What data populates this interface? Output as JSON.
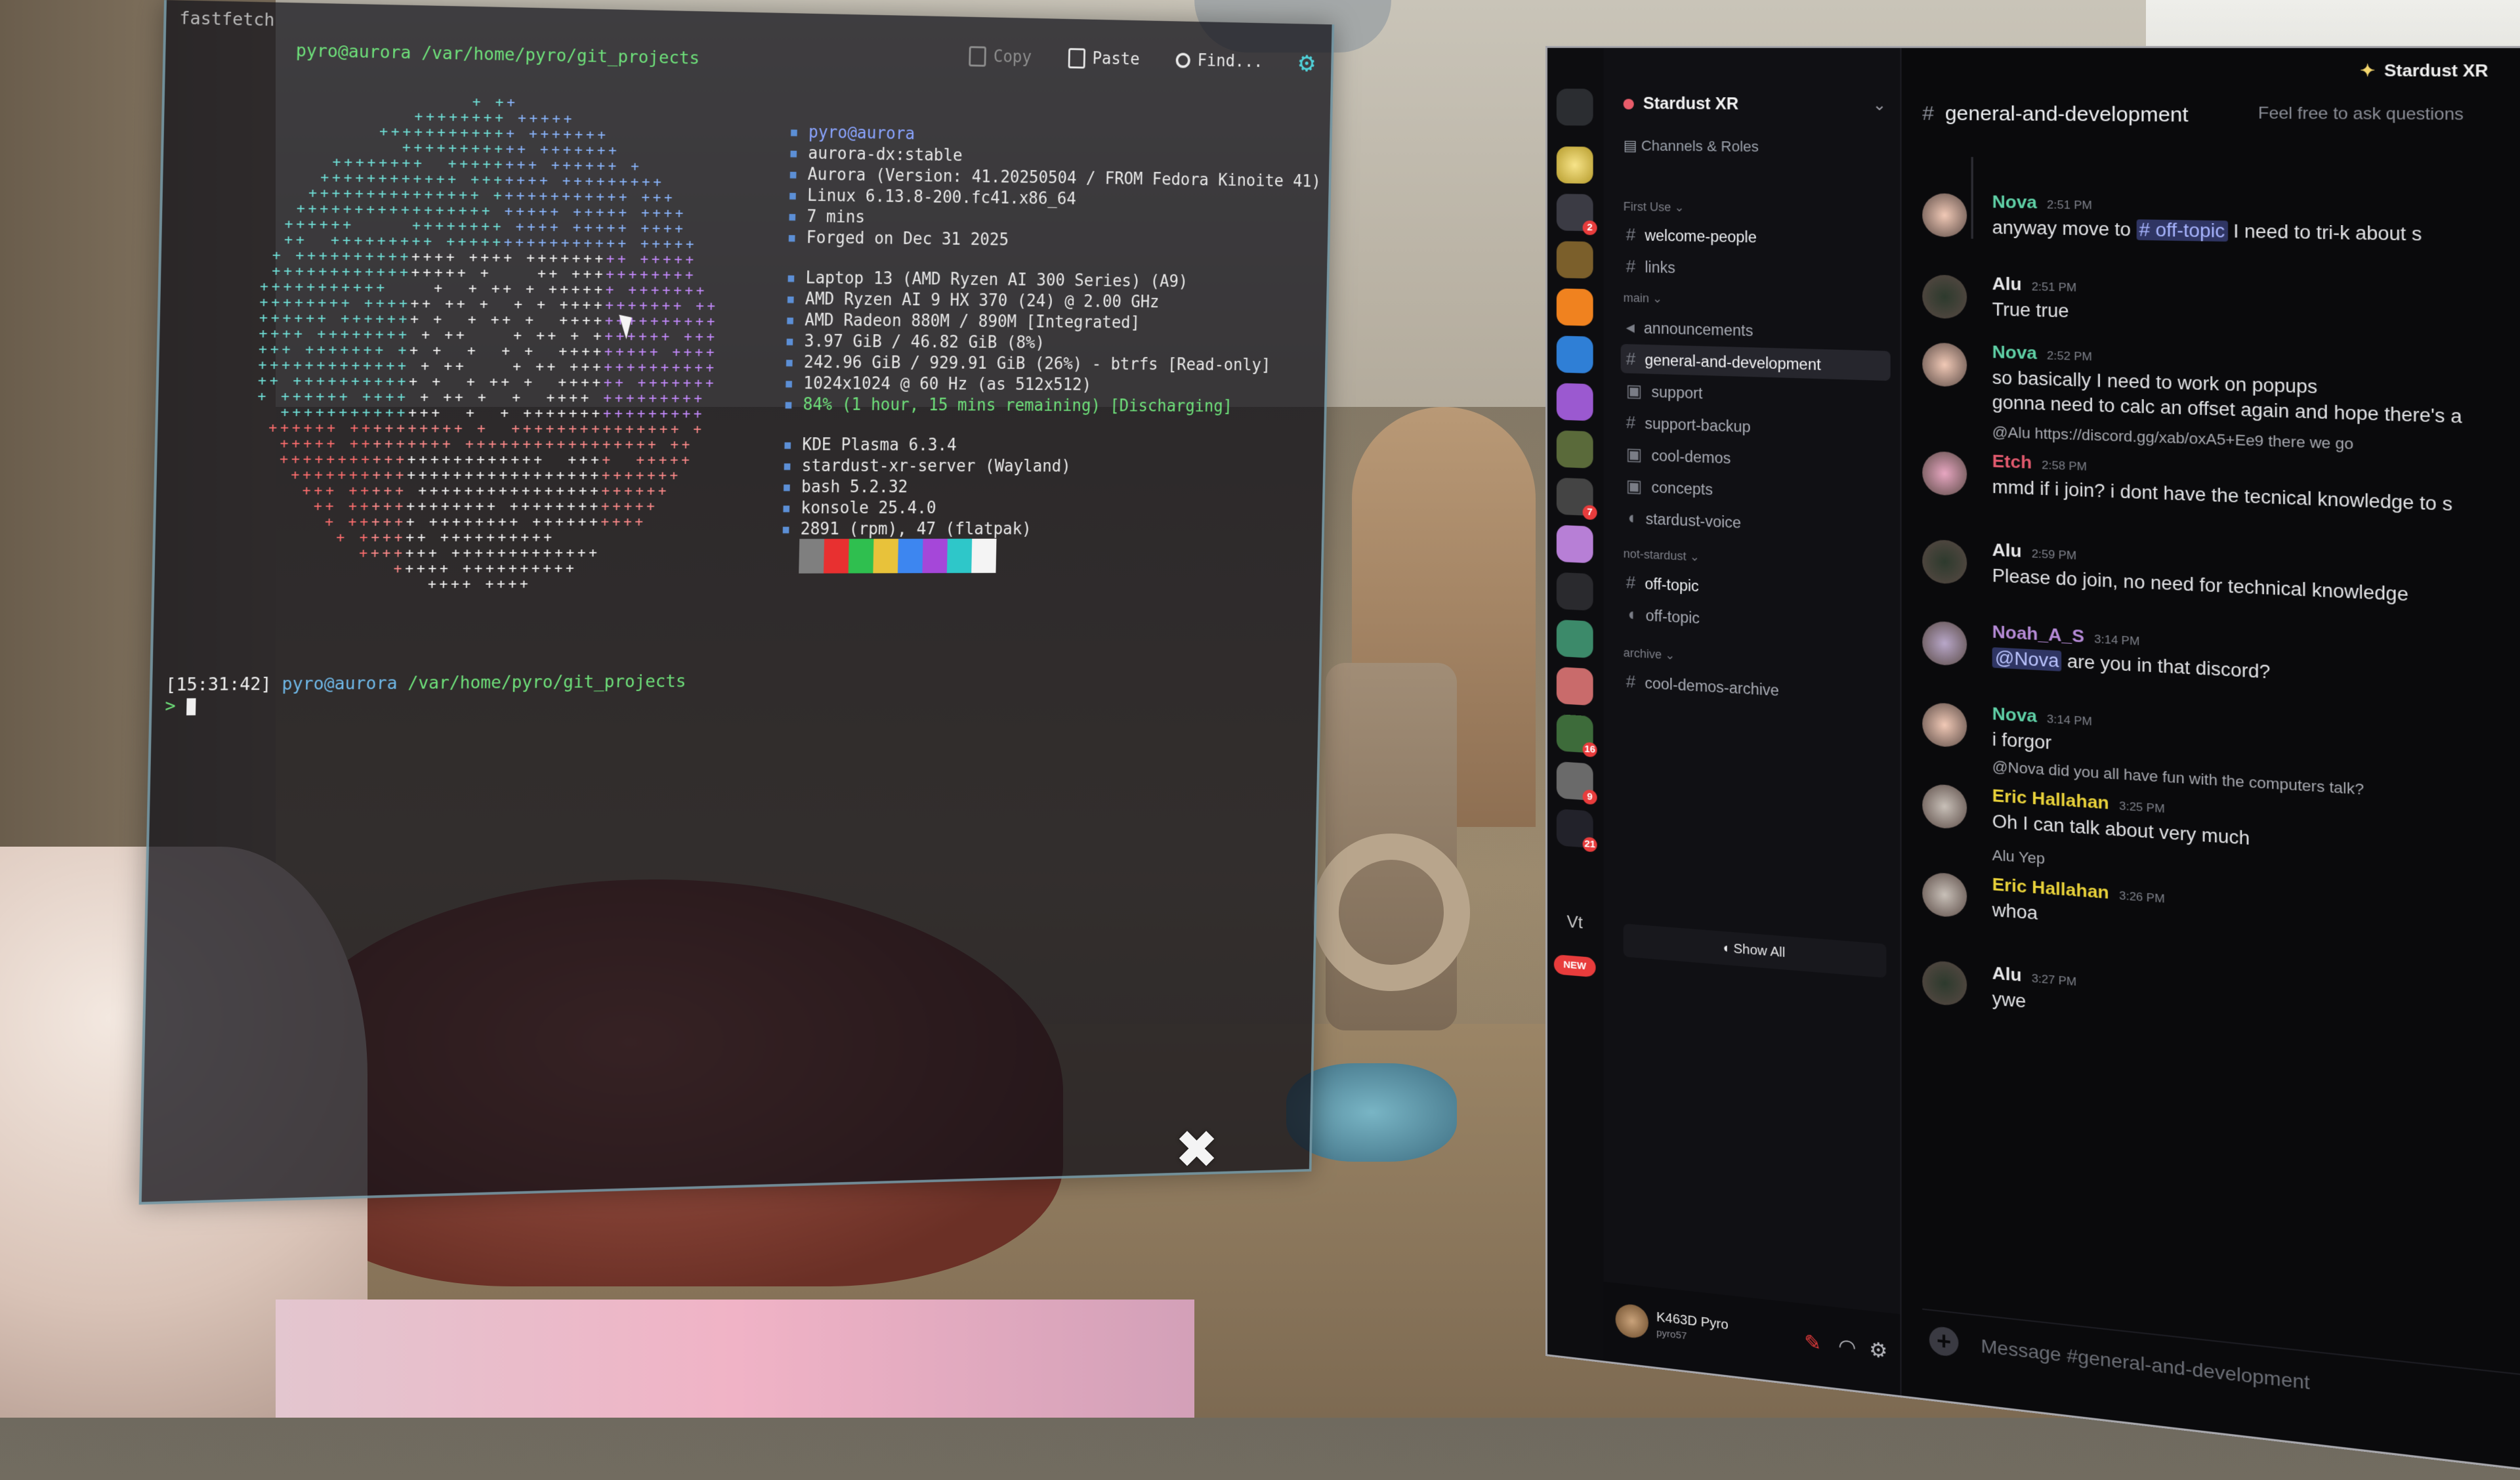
{
  "terminal": {
    "top_line": "fastfetch",
    "top_path": "pyro@aurora /var/home/pyro/git_projects",
    "toolbar": {
      "copy": "Copy",
      "paste": "Paste",
      "find": "Find..."
    },
    "user_host": "pyro@aurora",
    "info": [
      "aurora-dx:stable",
      "Aurora (Version: 41.20250504 / FROM Fedora Kinoite 41)",
      "Linux 6.13.8-200.fc41.x86_64",
      "7 mins",
      "Forged on Dec 31 2025",
      "",
      "Laptop 13 (AMD Ryzen AI 300 Series) (A9)",
      "AMD Ryzen AI 9 HX 370 (24) @ 2.00 GHz",
      "AMD Radeon 880M / 890M [Integrated]",
      "3.97 GiB / 46.82 GiB (8%)",
      "242.96 GiB / 929.91 GiB (26%) - btrfs [Read-only]",
      "1024x1024 @ 60 Hz (as 512x512)",
      "84% (1 hour, 15 mins remaining) [Discharging]",
      "",
      "KDE Plasma 6.3.4",
      "stardust-xr-server (Wayland)",
      "bash 5.2.32",
      "konsole 25.4.0",
      "2891 (rpm), 47 (flatpak)"
    ],
    "prompt_time": "[15:31:42]",
    "prompt_user": "pyro@aurora",
    "prompt_path": "/var/home/pyro/git_projects",
    "prompt_symbol": ">",
    "swatch_colors": [
      "#7f7f7f",
      "#e83030",
      "#2fbf4f",
      "#e8c23a",
      "#3d86f0",
      "#a547d9",
      "#2ec7c9",
      "#f4f4f4"
    ],
    "close_glyph": "✖"
  },
  "discord": {
    "brand": "Stardust XR",
    "server_name": "Stardust XR",
    "channels_roles": "Channels & Roles",
    "categories": {
      "first": "First Use",
      "main": "main",
      "not_stardust": "not-stardust",
      "archive": "archive"
    },
    "channels": [
      {
        "name": "welcome-people",
        "cat": "first"
      },
      {
        "name": "links",
        "cat": "first"
      },
      {
        "name": "announcements",
        "cat": "main"
      },
      {
        "name": "general-and-development",
        "cat": "main"
      },
      {
        "name": "support",
        "cat": "main"
      },
      {
        "name": "support-backup",
        "cat": "main"
      },
      {
        "name": "cool-demos",
        "cat": "main"
      },
      {
        "name": "concepts",
        "cat": "main"
      },
      {
        "name": "stardust-voice",
        "cat": "main"
      },
      {
        "name": "off-topic",
        "cat": "not_stardust"
      },
      {
        "name": "off-topic",
        "cat": "not_stardust"
      },
      {
        "name": "cool-demos-archive",
        "cat": "archive"
      }
    ],
    "show_all": "Show All",
    "user": {
      "name": "K463D Pyro",
      "sub": "pyro57"
    },
    "chat_header": "general-and-development",
    "chat_topic": "Feel free to ask questions",
    "messages": [
      {
        "name": "Nova",
        "time": "2:51 PM",
        "color": "#5fd0a6",
        "text_pre": "anyway move to",
        "chan": "# off-topic",
        "text_post": "I need to tri-k about s"
      },
      {
        "name": "Alu",
        "time": "2:51 PM",
        "color": "#e8e8ea",
        "text": "True true"
      },
      {
        "name": "Nova",
        "time": "2:52 PM",
        "color": "#5fd0a6",
        "text": "so basically I need to work on popups",
        "text2": "gonna need to calc an offset again and hope there's a"
      },
      {
        "name": "Etch",
        "time": "2:58 PM",
        "color": "#e25a6e",
        "reply": "@Alu https://discord.gg/xab/oxA5+Ee9 there we go",
        "text": "mmd if i join? i dont have the tecnical knowledge to s"
      },
      {
        "name": "Alu",
        "time": "2:59 PM",
        "color": "#e8e8ea",
        "text": "Please do join, no need for technical knowledge"
      },
      {
        "name": "Noah_A_S",
        "time": "3:14 PM",
        "color": "#b58ad6",
        "mention": "@Nova",
        "text": "are you in that discord?"
      },
      {
        "name": "Nova",
        "time": "3:14 PM",
        "color": "#5fd0a6",
        "text": "i forgor"
      },
      {
        "name": "Eric Hallahan",
        "time": "3:25 PM",
        "color": "#e8d13a",
        "reply": "@Nova did you all have fun with the computers talk?",
        "text": "Oh I can talk about very much"
      },
      {
        "name": "Eric Hallahan",
        "time": "3:26 PM",
        "color": "#e8d13a",
        "reply": "Alu Yep",
        "text": "whoa"
      },
      {
        "name": "Alu",
        "time": "3:27 PM",
        "color": "#e8e8ea",
        "text": "ywe"
      }
    ],
    "composer_placeholder": "Message #general-and-development",
    "guild_badges": [
      "2",
      "7",
      "16",
      "9",
      "21"
    ],
    "guild_text": "Vt",
    "new_pill": "NEW"
  }
}
